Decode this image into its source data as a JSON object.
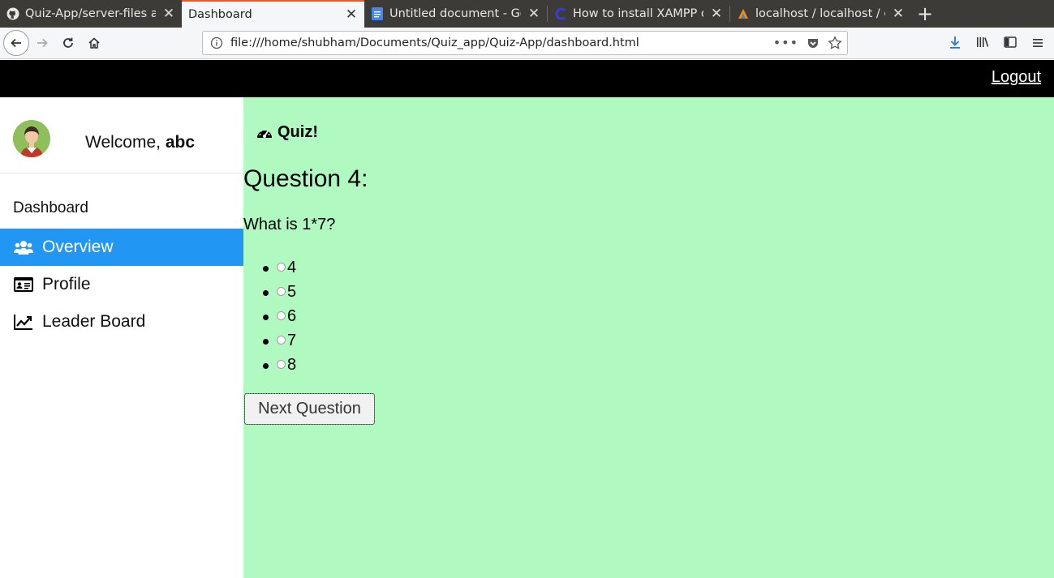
{
  "browser": {
    "tabs": [
      {
        "title": "Quiz-App/server-files at",
        "icon": "github-icon",
        "active": false
      },
      {
        "title": "Dashboard",
        "icon": "",
        "active": true
      },
      {
        "title": "Untitled document - Goo",
        "icon": "google-docs-icon",
        "active": false
      },
      {
        "title": "How to install XAMPP on",
        "icon": "site-icon",
        "active": false
      },
      {
        "title": "localhost / localhost / qu",
        "icon": "phpmyadmin-icon",
        "active": false
      }
    ],
    "url": "file:///home/shubham/Documents/Quiz_app/Quiz-App/dashboard.html",
    "colors": {
      "tab_strip": "#3c3b37",
      "active_tab_accent": "#e9592c"
    }
  },
  "topbar": {
    "logout_label": "Logout"
  },
  "sidebar": {
    "welcome_prefix": "Welcome, ",
    "username": "abc",
    "section_heading": "Dashboard",
    "items": [
      {
        "label": "Overview",
        "icon": "users-icon",
        "active": true
      },
      {
        "label": "Profile",
        "icon": "id-card-icon",
        "active": false
      },
      {
        "label": "Leader Board",
        "icon": "line-chart-icon",
        "active": false
      }
    ],
    "active_color": "#2196f3"
  },
  "main": {
    "background": "#b0f9c0",
    "quiz_label": "Quiz!",
    "question_title": "Question 4:",
    "question_text": "What is 1*7?",
    "options": [
      "4",
      "5",
      "6",
      "7",
      "8"
    ],
    "next_button_label": "Next Question"
  }
}
